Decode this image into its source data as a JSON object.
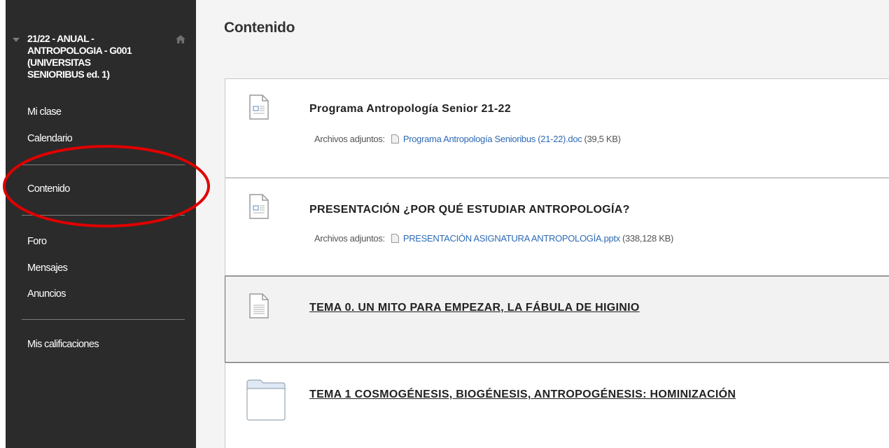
{
  "sidebar": {
    "course_title": "21/22 - ANUAL -\nANTROPOLOGIA - G001\n(UNIVERSITAS\nSENIORIBUS ed. 1)",
    "items": [
      {
        "label": "Mi clase"
      },
      {
        "label": "Calendario"
      },
      {
        "label": "Contenido"
      },
      {
        "label": "Foro"
      },
      {
        "label": "Mensajes"
      },
      {
        "label": "Anuncios"
      },
      {
        "label": "Mis calificaciones"
      }
    ]
  },
  "main": {
    "title": "Contenido",
    "items": [
      {
        "title": "Programa Antropología Senior 21-22",
        "attach_label": "Archivos adjuntos:",
        "attach_file": "Programa Antropología Senioribus (21-22).doc",
        "attach_size": "(39,5 KB)",
        "icon": "document-icon"
      },
      {
        "title": "PRESENTACIÓN ¿POR QUÉ ESTUDIAR ANTROPOLOGÍA?",
        "attach_label": "Archivos adjuntos:",
        "attach_file": "PRESENTACIÓN ASIGNATURA ANTROPOLOGÍA.pptx",
        "attach_size": "(338,128 KB)",
        "icon": "document-icon"
      },
      {
        "title": "TEMA 0. UN MITO PARA EMPEZAR, LA FÁBULA DE HIGINIO",
        "icon": "text-document-icon"
      },
      {
        "title": "TEMA 1 COSMOGÉNESIS, BIOGÉNESIS, ANTROPOGÉNESIS: HOMINIZACIÓN",
        "icon": "folder-icon"
      }
    ]
  },
  "colors": {
    "sidebar_bg": "#2b2b2b",
    "link_blue": "#2f6bb6",
    "annotation_red": "#e00000"
  }
}
